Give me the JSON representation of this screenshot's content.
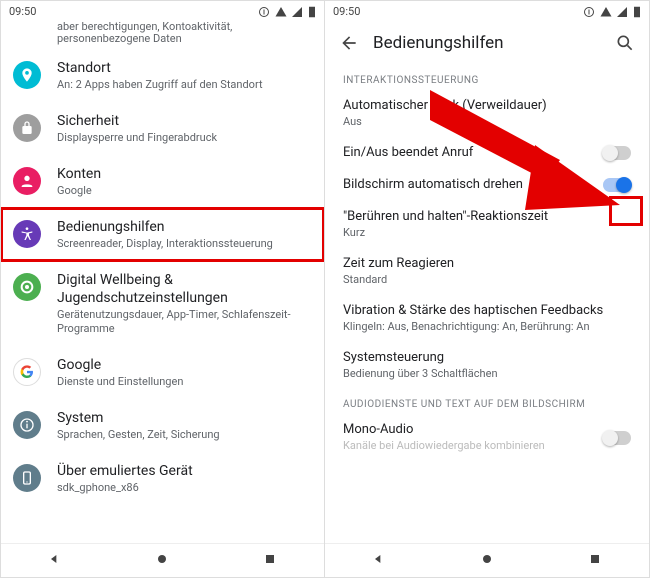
{
  "status": {
    "time": "09:50"
  },
  "left": {
    "cut_top": "aber berechtigungen, Kontoaktivität, personenbezogene Daten",
    "items": [
      {
        "title": "Standort",
        "sub": "An: 2 Apps haben Zugriff auf den Standort",
        "color": "#00bcd4"
      },
      {
        "title": "Sicherheit",
        "sub": "Displaysperre und Fingerabdruck",
        "color": "#9e9e9e"
      },
      {
        "title": "Konten",
        "sub": "Google",
        "color": "#e91e63"
      },
      {
        "title": "Bedienungshilfen",
        "sub": "Screenreader, Display, Interaktionssteuerung",
        "color": "#673ab7"
      },
      {
        "title": "Digital Wellbeing & Jugendschutzeinstellungen",
        "sub": "Gerätenutzungsdauer, App-Timer, Schlafenszeit-Programme",
        "color": "#4caf50"
      },
      {
        "title": "Google",
        "sub": "Dienste und Einstellungen",
        "color": "#ffffff"
      },
      {
        "title": "System",
        "sub": "Sprachen, Gesten, Zeit, Sicherung",
        "color": "#607d8b"
      },
      {
        "title": "Über emuliertes Gerät",
        "sub": "sdk_gphone_x86",
        "color": "#607d8b"
      }
    ]
  },
  "right": {
    "title": "Bedienungshilfen",
    "section1": "INTERAKTIONSSTEUERUNG",
    "prefs": [
      {
        "t": "Automatischer Klick (Verweildauer)",
        "s": "Aus"
      },
      {
        "t": "Ein/Aus beendet Anruf",
        "toggle": "off"
      },
      {
        "t": "Bildschirm automatisch drehen",
        "toggle": "on"
      },
      {
        "t": "\"Berühren und halten\"-Reaktionszeit",
        "s": "Kurz"
      },
      {
        "t": "Zeit zum Reagieren",
        "s": "Standard"
      },
      {
        "t": "Vibration & Stärke des haptischen Feedbacks",
        "s": "Klingeln: Aus, Benachrichtigung: An, Berührung: An"
      },
      {
        "t": "Systemsteuerung",
        "s": "Bedienung über 3 Schaltflächen"
      }
    ],
    "section2": "AUDIODIENSTE UND TEXT AUF DEM BILDSCHIRM",
    "mono": {
      "t": "Mono-Audio",
      "s": "Kanäle bei Audiowiedergabe kombinieren"
    }
  }
}
